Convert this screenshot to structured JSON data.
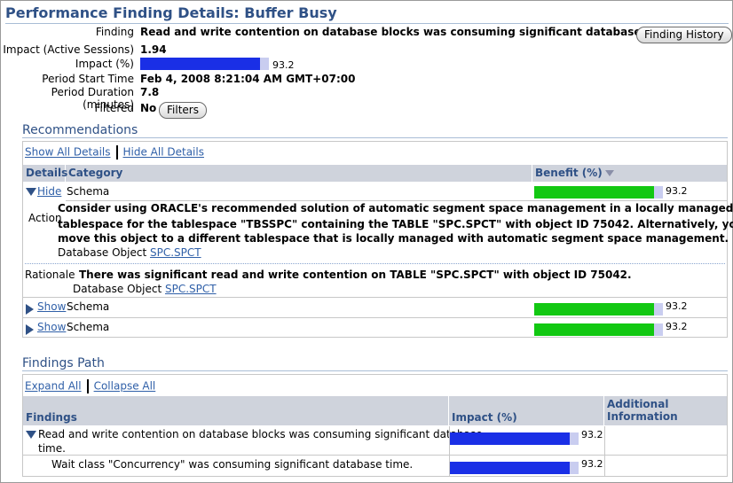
{
  "page": {
    "title": "Performance Finding Details: Buffer Busy"
  },
  "summary": {
    "finding_label": "Finding",
    "finding_value": "Read and write contention on database blocks was consuming significant database time.",
    "finding_history_button": "Finding History",
    "impact_sessions_label": "Impact (Active Sessions)",
    "impact_sessions_value": "1.94",
    "impact_pct_label": "Impact (%)",
    "impact_pct_value": "93.2",
    "impact_pct_fraction": 0.932,
    "period_start_label": "Period Start Time",
    "period_start_value": "Feb 4, 2008 8:21:04 AM GMT+07:00",
    "period_duration_label": "Period Duration (minutes)",
    "period_duration_value": "7.8",
    "filtered_label": "Filtered",
    "filtered_value": "No",
    "filters_button": "Filters"
  },
  "recommendations": {
    "title": "Recommendations",
    "show_all": "Show All Details",
    "hide_all": "Hide All Details",
    "columns": {
      "details": "Details",
      "category": "Category",
      "benefit": "Benefit (%)"
    },
    "rows": [
      {
        "toggle": "Hide",
        "category": "Schema",
        "benefit": "93.2",
        "benefit_fraction": 0.932,
        "expanded": true,
        "action_label": "Action",
        "action_text_1": "Consider using ORACLE's recommended solution of automatic segment space management in a locally managed",
        "action_text_2": "tablespace for the tablespace \"TBSSPC\" containing the TABLE \"SPC.SPCT\" with object ID 75042. Alternatively, you can",
        "action_text_3": "move this object to a different tablespace that is locally managed with automatic segment space management.",
        "db_object_label": "Database Object",
        "db_object_value": "SPC.SPCT",
        "rationale_label": "Rationale",
        "rationale_text": "There was significant read and write contention on TABLE \"SPC.SPCT\" with object ID 75042.",
        "rationale_db_object_label": "Database Object",
        "rationale_db_object_value": "SPC.SPCT"
      },
      {
        "toggle": "Show",
        "category": "Schema",
        "benefit": "93.2",
        "benefit_fraction": 0.932,
        "expanded": false
      },
      {
        "toggle": "Show",
        "category": "Schema",
        "benefit": "93.2",
        "benefit_fraction": 0.932,
        "expanded": false
      }
    ]
  },
  "findings_path": {
    "title": "Findings Path",
    "expand_all": "Expand All",
    "collapse_all": "Collapse All",
    "columns": {
      "findings": "Findings",
      "impact": "Impact (%)",
      "additional_1": "Additional",
      "additional_2": "Information"
    },
    "rows": [
      {
        "text_1": "Read and write contention on database blocks was consuming significant database",
        "text_2": "time.",
        "impact": "93.2",
        "impact_fraction": 0.932
      },
      {
        "text_1": "Wait class \"Concurrency\" was consuming significant database time.",
        "impact": "93.2",
        "impact_fraction": 0.932
      }
    ]
  },
  "colors": {
    "accent": "#2f5186",
    "impact_bar": "#1a2fe6",
    "benefit_bar": "#12c812",
    "bar_track": "#c9cdf0",
    "link": "#3060a8"
  }
}
